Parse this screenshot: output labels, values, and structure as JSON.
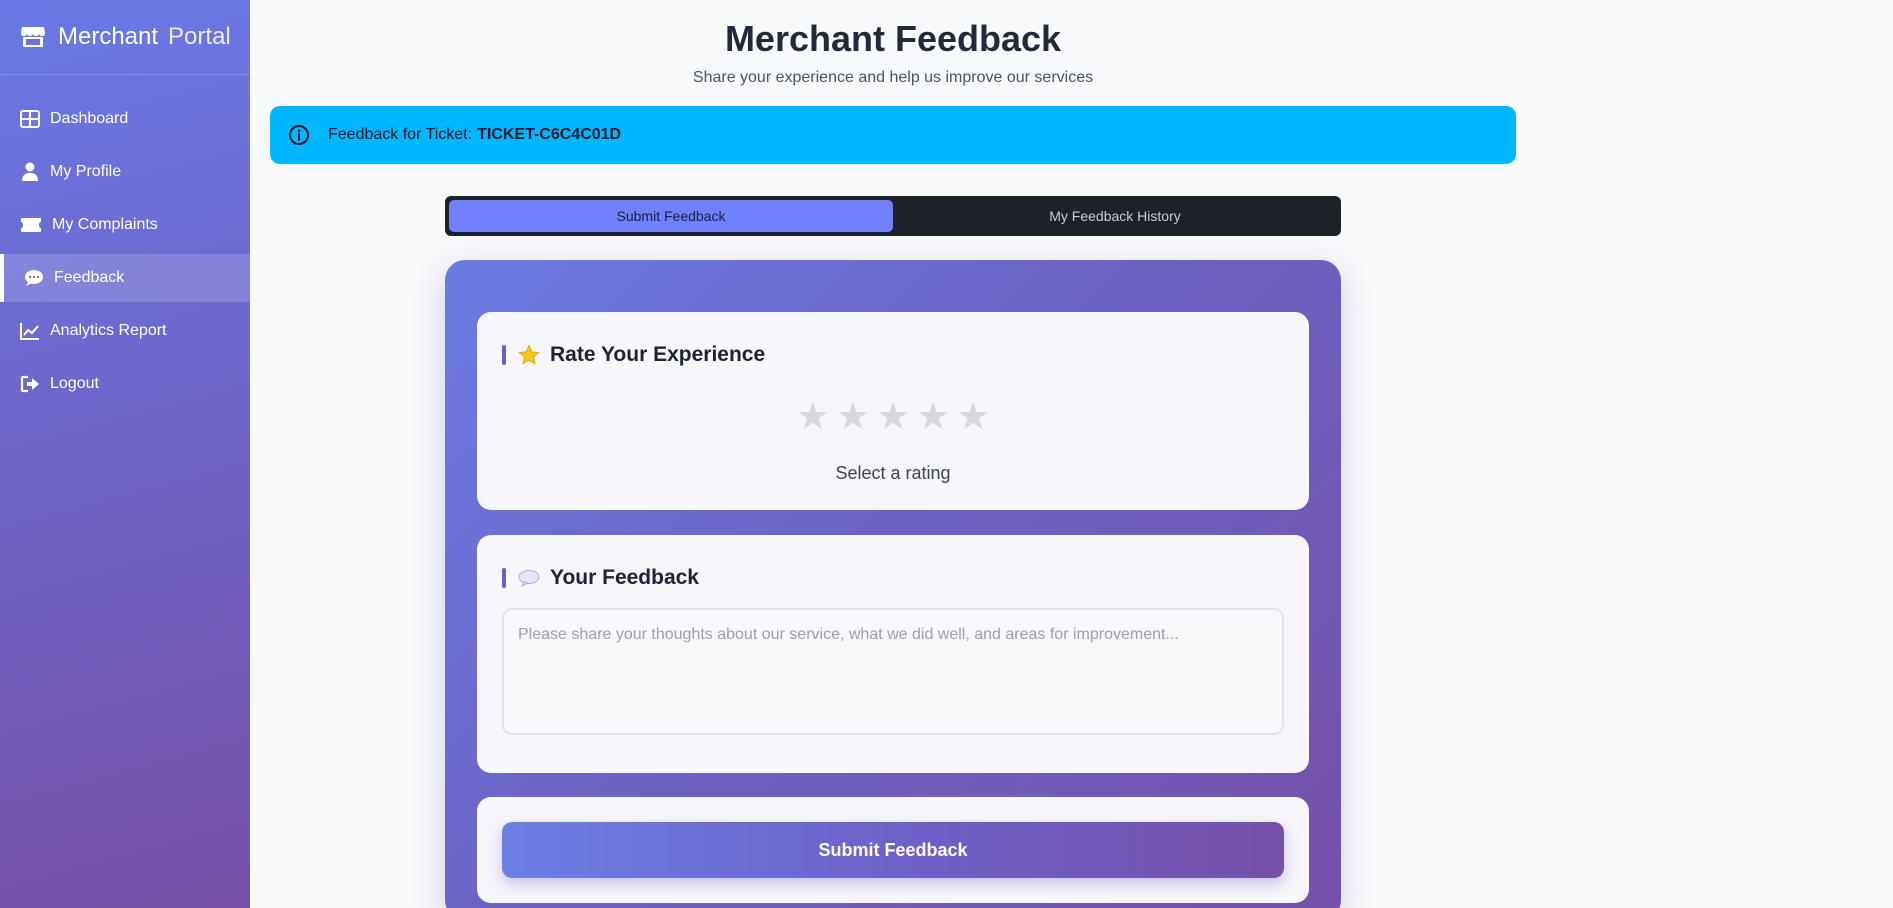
{
  "sidebar": {
    "brand_primary": "Merchant",
    "brand_secondary": "Portal",
    "items": [
      {
        "label": "Dashboard",
        "icon": "grid-icon"
      },
      {
        "label": "My Profile",
        "icon": "user-icon"
      },
      {
        "label": "My Complaints",
        "icon": "ticket-icon"
      },
      {
        "label": "Feedback",
        "icon": "chat-icon",
        "active": true
      },
      {
        "label": "Analytics Report",
        "icon": "chart-line-icon"
      },
      {
        "label": "Logout",
        "icon": "logout-icon"
      }
    ]
  },
  "header": {
    "title": "Merchant Feedback",
    "subtitle": "Share your experience and help us improve our services"
  },
  "alert": {
    "prefix": "Feedback for Ticket:",
    "ticket": "TICKET-C6C4C01D",
    "icon": "info-circle-icon",
    "color": "#00b6ff"
  },
  "tabs": [
    {
      "label": "Submit Feedback",
      "active": true
    },
    {
      "label": "My Feedback History",
      "active": false
    }
  ],
  "rating_section": {
    "title": "Rate Your Experience",
    "icon": "star-emoji",
    "stars": [
      "★",
      "★",
      "★",
      "★",
      "★"
    ],
    "selected": 0,
    "label": "Select a rating"
  },
  "feedback_section": {
    "title": "Your Feedback",
    "icon": "speech-bubble-emoji",
    "value": "",
    "placeholder": "Please share your thoughts about our service, what we did well, and areas for improvement..."
  },
  "submit": {
    "label": "Submit Feedback"
  },
  "colors": {
    "accent": "#7080ff",
    "sidebar_start": "#6a79e6",
    "sidebar_end": "#7650a8"
  }
}
